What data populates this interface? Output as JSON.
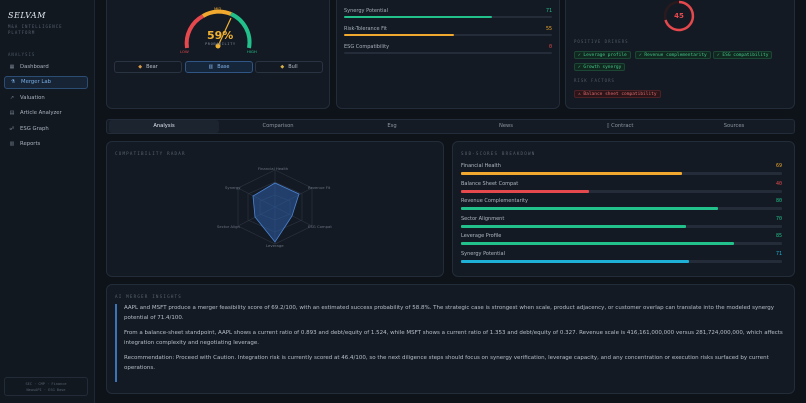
{
  "sidebar": {
    "brand": "SELVAM",
    "brand_sub": "M&A INTELLIGENCE PLATFORM",
    "section": "ANALYSIS",
    "items": [
      {
        "label": "Dashboard",
        "icon": "grid-icon"
      },
      {
        "label": "Merger Lab",
        "icon": "flask-icon"
      },
      {
        "label": "Valuation",
        "icon": "trend-icon"
      },
      {
        "label": "Article Analyzer",
        "icon": "doc-icon"
      },
      {
        "label": "ESG Graph",
        "icon": "graph-icon"
      },
      {
        "label": "Reports",
        "icon": "report-icon"
      }
    ],
    "footer_line1": "SEC · CMP · Finance",
    "footer_line2": "NewsAPI · ESG Base"
  },
  "gauge": {
    "value_text": "59%",
    "value": 59,
    "sub": "PROBABILITY",
    "tick_top": "MID",
    "tick_left": "LOW",
    "tick_right": "HIGH",
    "scenarios": [
      "Bear",
      "Base",
      "Bull"
    ],
    "active_scenario": "Base"
  },
  "synergy": {
    "rows": [
      {
        "label": "Synergy Potential",
        "value": "71",
        "fill": 0.71,
        "color": "#22c08a"
      },
      {
        "label": "Risk-Tolerance Fit",
        "value": "55",
        "fill": 0.53,
        "color": "#f0a92e"
      },
      {
        "label": "ESG Compatibility",
        "value": "0",
        "fill": 0,
        "color": "#e5484d"
      }
    ]
  },
  "score": {
    "ring_value": "45",
    "positive_label": "POSITIVE DRIVERS",
    "positives": [
      "Leverage profile",
      "Revenue complementarity",
      "ESG compatibility",
      "Growth synergy"
    ],
    "risk_label": "RISK FACTORS",
    "risks": [
      "Balance sheet compatibility"
    ]
  },
  "tabs": [
    "Analysis",
    "Comparison",
    "Esg",
    "News",
    "Contract",
    "Sources"
  ],
  "active_tab": "Analysis",
  "radar": {
    "title": "COMPATIBILITY RADAR",
    "axes": [
      "Financial Health",
      "Revenue Fit",
      "ESG Compat",
      "Leverage",
      "Sector Align",
      "Synergy"
    ]
  },
  "breakdown": {
    "title": "SUB-SCORES BREAKDOWN",
    "rows": [
      {
        "label": "Financial Health",
        "value": "69",
        "fill": 0.69,
        "color": "#f0a92e"
      },
      {
        "label": "Balance Sheet Compat",
        "value": "40",
        "fill": 0.4,
        "color": "#e5484d"
      },
      {
        "label": "Revenue Complementarity",
        "value": "80",
        "fill": 0.8,
        "color": "#22c08a"
      },
      {
        "label": "Sector Alignment",
        "value": "70",
        "fill": 0.7,
        "color": "#22c08a"
      },
      {
        "label": "Leverage Profile",
        "value": "85",
        "fill": 0.85,
        "color": "#22c08a"
      },
      {
        "label": "Synergy Potential",
        "value": "71",
        "fill": 0.71,
        "color": "#1fb0d8"
      }
    ]
  },
  "insights": {
    "title": "AI MERGER INSIGHTS",
    "paragraphs": [
      "AAPL and MSFT produce a merger feasibility score of 69.2/100, with an estimated success probability of 58.8%. The strategic case is strongest when scale, product adjacency, or customer overlap can translate into the modeled synergy potential of 71.4/100.",
      "From a balance-sheet standpoint, AAPL shows a current ratio of 0.893 and debt/equity of 1.524, while MSFT shows a current ratio of 1.353 and debt/equity of 0.327. Revenue scale is 416,161,000,000 versus 281,724,000,000, which affects integration complexity and negotiating leverage.",
      "Recommendation: Proceed with Caution. Integration risk is currently scored at 46.4/100, so the next diligence steps should focus on synergy verification, leverage capacity, and any concentration or execution risks surfaced by current operations."
    ]
  }
}
